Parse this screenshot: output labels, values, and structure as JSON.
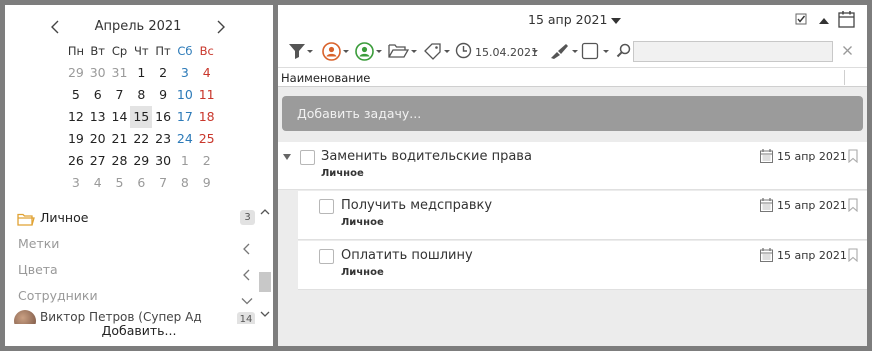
{
  "calendar": {
    "month_label": "Апрель 2021",
    "weekdays": [
      "Пн",
      "Вт",
      "Ср",
      "Чт",
      "Пт",
      "Сб",
      "Вс"
    ],
    "days": [
      [
        "29",
        "30",
        "31",
        "1",
        "2",
        "3",
        "4"
      ],
      [
        "5",
        "6",
        "7",
        "8",
        "9",
        "10",
        "11"
      ],
      [
        "12",
        "13",
        "14",
        "15",
        "16",
        "17",
        "18"
      ],
      [
        "19",
        "20",
        "21",
        "22",
        "23",
        "24",
        "25"
      ],
      [
        "26",
        "27",
        "28",
        "29",
        "30",
        "1",
        "2"
      ],
      [
        "3",
        "4",
        "5",
        "6",
        "7",
        "8",
        "9"
      ]
    ],
    "today": "15"
  },
  "sidebar": {
    "project": {
      "label": "Личное",
      "count": "3"
    },
    "labels_label": "Метки",
    "colors_label": "Цвета",
    "employees_label": "Сотрудники",
    "user": {
      "name": "Виктор Петров (Супер Ад",
      "count": "14"
    },
    "add_label": "Добавить..."
  },
  "header": {
    "date_label": "15 апр 2021"
  },
  "toolbar": {
    "date_filter_label": "15.04.2021"
  },
  "search": {
    "value": "",
    "placeholder": ""
  },
  "columns": {
    "name_label": "Наименование"
  },
  "add_task": {
    "placeholder": "Добавить задачу..."
  },
  "tasks": [
    {
      "title": "Заменить водительские права",
      "project": "Личное",
      "due": "15 апр 2021"
    },
    {
      "title": "Получить медсправку",
      "project": "Личное",
      "due": "15 апр 2021"
    },
    {
      "title": "Оплатить пошлину",
      "project": "Личное",
      "due": "15 апр 2021"
    }
  ],
  "colors": {
    "weekend_saturday": "#2c7ab8",
    "weekend_sunday": "#c9372c",
    "folder_icon": "#e0a233",
    "assignee_icon": "#d9622b",
    "performer_icon": "#3a9c3a",
    "add_task_bar": "#9b9b9b"
  }
}
